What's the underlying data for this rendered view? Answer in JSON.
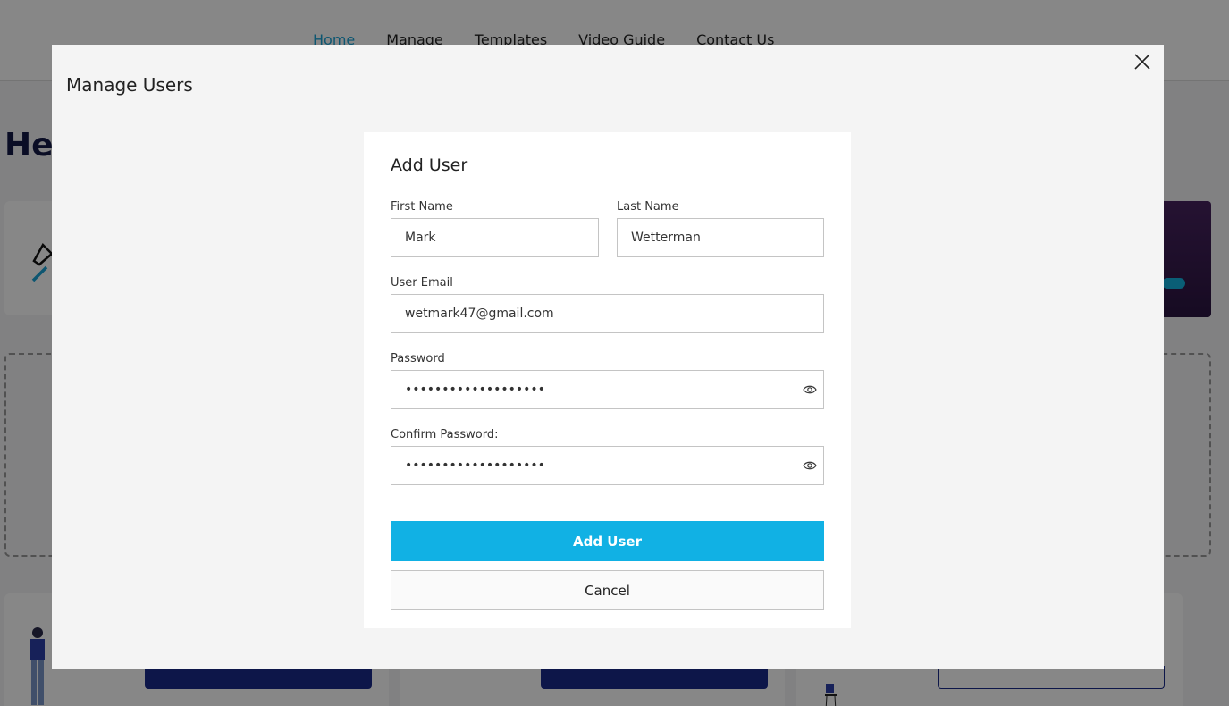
{
  "nav": {
    "items": [
      {
        "label": "Home",
        "active": true
      },
      {
        "label": "Manage",
        "active": false
      },
      {
        "label": "Templates",
        "active": false
      },
      {
        "label": "Video Guide",
        "active": false
      },
      {
        "label": "Contact Us",
        "active": false
      }
    ]
  },
  "background": {
    "heading_partial": "He"
  },
  "modal": {
    "title": "Manage Users",
    "close_icon": "close-icon"
  },
  "form": {
    "title": "Add User",
    "first_name": {
      "label": "First Name",
      "value": "Mark"
    },
    "last_name": {
      "label": "Last Name",
      "value": "Wetterman"
    },
    "email": {
      "label": "User Email",
      "value": "wetmark47@gmail.com"
    },
    "password": {
      "label": "Password",
      "value": "qwertyuiopasdfghjkl",
      "icon": "eye-icon"
    },
    "confirm_password": {
      "label": "Confirm Password:",
      "value": "qwertyuiopasdfghjkl",
      "icon": "eye-icon"
    },
    "submit_label": "Add User",
    "cancel_label": "Cancel"
  },
  "colors": {
    "accent": "#11b1e4",
    "nav_active": "#1aa3d6",
    "heading_navy": "#141a46",
    "overlay": "rgba(0,0,0,0.47)"
  }
}
